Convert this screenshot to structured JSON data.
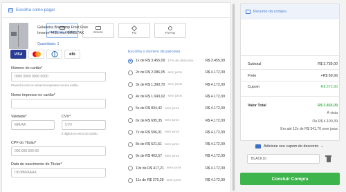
{
  "payment": {
    "header": "Escolha como pagar",
    "tabs": [
      {
        "label": "Cartão de Crédito",
        "active": true
      },
      {
        "label": "Boleto",
        "active": false
      },
      {
        "label": "Pix",
        "active": false
      },
      {
        "label": "PicPay",
        "active": false
      }
    ],
    "brands": [
      "VISA",
      "Mastercard",
      "Diners Club",
      "elo"
    ],
    "card_number": {
      "label": "Número do cartão*",
      "placeholder": "0000 0000 0000 0000",
      "hint": "Preencha com os números impressos no seu cartão."
    },
    "card_name": {
      "label": "Nome impresso no cartão*",
      "placeholder": ""
    },
    "expiry": {
      "label": "Validade*",
      "placeholder": "MM/AA"
    },
    "cvv": {
      "label": "CVV*",
      "placeholder": "CVV",
      "hint": "3 dígitos no verso do cartão."
    },
    "cpf": {
      "label": "CPF do Titular*",
      "placeholder": "000.000.000-00"
    },
    "birth": {
      "label": "Data de nascimento do Titular*",
      "placeholder": "DD/MM/AAAA"
    },
    "installments_title": "Escolha o número de parcelas",
    "installments": [
      {
        "label": "1x de R$ 3.455,09",
        "note": "17% de desconto",
        "total": "R$ 3.455,09",
        "selected": true
      },
      {
        "label": "2x de R$ 2.086,05",
        "note": "sem juros",
        "total": "R$ 4.172,09",
        "selected": false
      },
      {
        "label": "3x de R$ 1.390,70",
        "note": "sem juros",
        "total": "R$ 4.172,09",
        "selected": false
      },
      {
        "label": "4x de R$ 1.043,02",
        "note": "sem juros",
        "total": "R$ 4.172,09",
        "selected": false
      },
      {
        "label": "5x de R$ 834,42",
        "note": "sem juros",
        "total": "R$ 4.172,09",
        "selected": false
      },
      {
        "label": "6x de R$ 695,35",
        "note": "sem juros",
        "total": "R$ 4.172,09",
        "selected": false
      },
      {
        "label": "7x de R$ 596,01",
        "note": "sem juros",
        "total": "R$ 4.172,09",
        "selected": false
      },
      {
        "label": "8x de R$ 521,51",
        "note": "sem juros",
        "total": "R$ 4.172,09",
        "selected": false
      },
      {
        "label": "9x de R$ 463,57",
        "note": "sem juros",
        "total": "R$ 4.172,09",
        "selected": false
      },
      {
        "label": "10x de R$ 417,21",
        "note": "sem juros",
        "total": "R$ 4.172,09",
        "selected": false
      },
      {
        "label": "11x de R$ 379,28",
        "note": "sem juros",
        "total": "R$ 4.172,09",
        "selected": false
      }
    ]
  },
  "summary": {
    "header": "Resumo da compra",
    "product_name": "Geladeira Brastemp Frost Free Inverse 443L Inox BRE57AK",
    "quantity": "Quantidade: 1",
    "subtotal_label": "Subtotal",
    "subtotal": "R$ 3.739,00",
    "frete_label": "Frete",
    "frete": "+R$ 89,99",
    "cupom_label": "Cupom",
    "cupom": "-R$ 373,90",
    "total_label": "Valor Total",
    "total": "R$ 3.455,09",
    "avista": "À vista",
    "ou": "Ou R$ 4.100,39",
    "parcelas": "Em até 12x de R$ 341,70 sem juros"
  },
  "coupon": {
    "toggle_label": "Adicione seu cupom de desconto",
    "value": "BLACK10"
  },
  "buy_button": "Concluir Compra",
  "colors": {
    "accent": "#4a7fd1",
    "green": "#3db54c"
  }
}
